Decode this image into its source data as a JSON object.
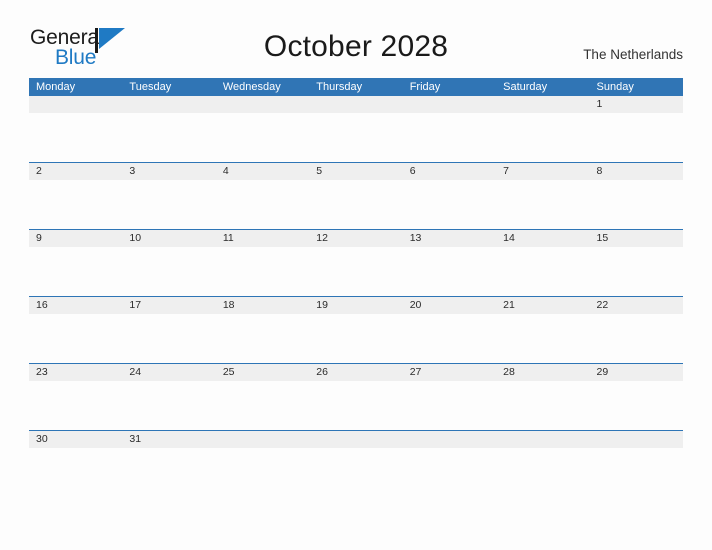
{
  "brand": {
    "name_part1": "General",
    "name_part2": "Blue",
    "flag_icon": "triangle-flag-icon",
    "accent_color": "#1f7ac4"
  },
  "header": {
    "title": "October 2028",
    "country": "The Netherlands"
  },
  "colors": {
    "header_blue": "#3075b5",
    "rule_blue": "#2e75b6",
    "number_band_grey": "#efefef",
    "page_background": "#fdfdfd"
  },
  "calendar": {
    "weekdays": [
      "Monday",
      "Tuesday",
      "Wednesday",
      "Thursday",
      "Friday",
      "Saturday",
      "Sunday"
    ],
    "weeks": [
      [
        "",
        "",
        "",
        "",
        "",
        "",
        "1"
      ],
      [
        "2",
        "3",
        "4",
        "5",
        "6",
        "7",
        "8"
      ],
      [
        "9",
        "10",
        "11",
        "12",
        "13",
        "14",
        "15"
      ],
      [
        "16",
        "17",
        "18",
        "19",
        "20",
        "21",
        "22"
      ],
      [
        "23",
        "24",
        "25",
        "26",
        "27",
        "28",
        "29"
      ],
      [
        "30",
        "31",
        "",
        "",
        "",
        "",
        ""
      ]
    ]
  }
}
